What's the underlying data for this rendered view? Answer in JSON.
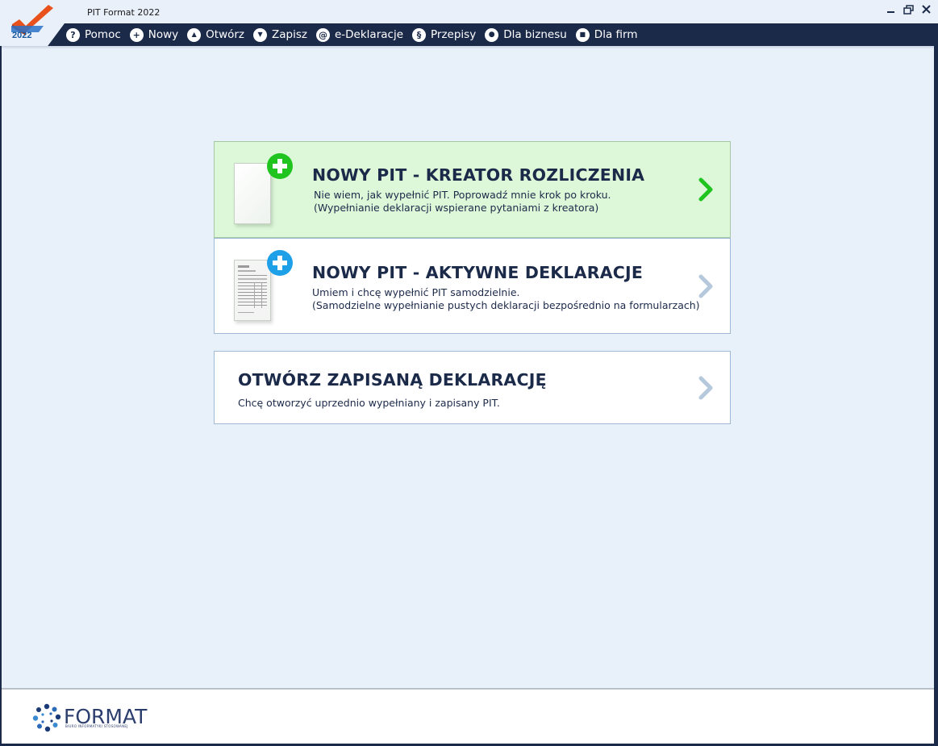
{
  "window": {
    "title": "PIT Format 2022",
    "logo_year": "2022"
  },
  "menu": {
    "items": [
      {
        "label": "Pomoc",
        "icon": "question-icon",
        "glyph": "?"
      },
      {
        "label": "Nowy",
        "icon": "plus-icon",
        "glyph": "+"
      },
      {
        "label": "Otwórz",
        "icon": "open-icon",
        "glyph": "▲"
      },
      {
        "label": "Zapisz",
        "icon": "save-icon",
        "glyph": "▼"
      },
      {
        "label": "e-Deklaracje",
        "icon": "at-icon",
        "glyph": "@"
      },
      {
        "label": "Przepisy",
        "icon": "paragraph-icon",
        "glyph": "§"
      },
      {
        "label": "Dla biznesu",
        "icon": "handshake-icon",
        "glyph": "●"
      },
      {
        "label": "Dla firm",
        "icon": "briefcase-icon",
        "glyph": "■"
      }
    ]
  },
  "cards": {
    "wizard": {
      "title": "NOWY PIT - KREATOR ROZLICZENIA",
      "desc_line1": "Nie wiem, jak wypełnić PIT. Poprowadź mnie krok po kroku.",
      "desc_line2": "(Wypełnianie deklaracji wspierane pytaniami z kreatora)",
      "accent": "#1fc41f"
    },
    "active_forms": {
      "title": "NOWY PIT - AKTYWNE DEKLARACJE",
      "desc_line1": "Umiem i chcę wypełnić PIT samodzielnie.",
      "desc_line2": "(Samodzielne wypełnianie pustych deklaracji bezpośrednio na formularzach)",
      "accent": "#1ea0e8"
    },
    "open_saved": {
      "title": "OTWÓRZ ZAPISANĄ DEKLARACJĘ",
      "desc_line1": "Chcę otworzyć uprzednio wypełniany i zapisany PIT."
    }
  },
  "footer": {
    "brand": "FORMAT",
    "subtitle": "BIURO INFORMATYKI STOSOWANEJ"
  }
}
